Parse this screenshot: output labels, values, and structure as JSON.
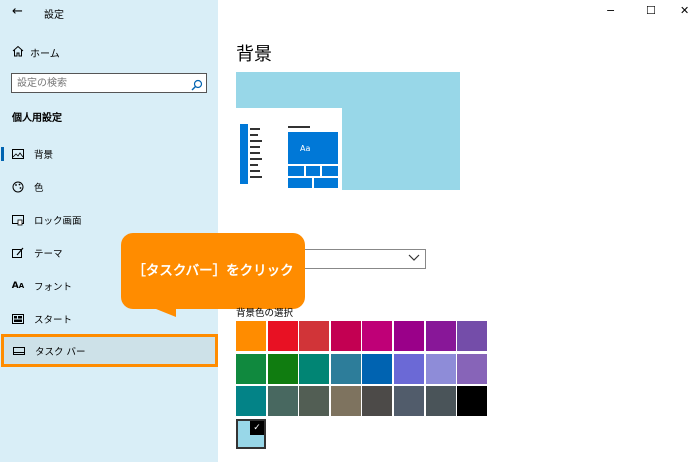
{
  "window": {
    "title": "設定",
    "back_glyph": "←",
    "minimize_glyph": "−",
    "maximize_glyph": "☐",
    "close_glyph": "✕"
  },
  "sidebar": {
    "home_label": "ホーム",
    "search_placeholder": "設定の検索",
    "section_title": "個人用設定",
    "items": [
      {
        "label": "背景",
        "icon": "picture-icon"
      },
      {
        "label": "色",
        "icon": "palette-icon"
      },
      {
        "label": "ロック画面",
        "icon": "lock-screen-icon"
      },
      {
        "label": "テーマ",
        "icon": "theme-brush-icon"
      },
      {
        "label": "フォント",
        "icon": "font-icon"
      },
      {
        "label": "スタート",
        "icon": "start-icon"
      },
      {
        "label": "タスク バー",
        "icon": "taskbar-icon"
      }
    ]
  },
  "main": {
    "title": "背景",
    "preview_tile_text": "Aa",
    "color_label": "背景色の選択",
    "swatch_colors": [
      "#ff8c00",
      "#e81123",
      "#d13438",
      "#c30052",
      "#bf0077",
      "#9a0089",
      "#881798",
      "#744da9",
      "#10893e",
      "#107c10",
      "#018574",
      "#2d7d9a",
      "#0063b1",
      "#6b69d6",
      "#8e8cd8",
      "#8764b8",
      "#038387",
      "#486860",
      "#525e54",
      "#7e735f",
      "#4c4a48",
      "#515c6b",
      "#4a5459",
      "#000000"
    ],
    "selected_color": "#98d7e8",
    "selected_check": "✓"
  },
  "callout": {
    "text": "［タスクバー］をクリック",
    "color": "#ff8c00"
  },
  "colors": {
    "sidebar_bg": "#d9eef7",
    "accent": "#0078d7"
  }
}
